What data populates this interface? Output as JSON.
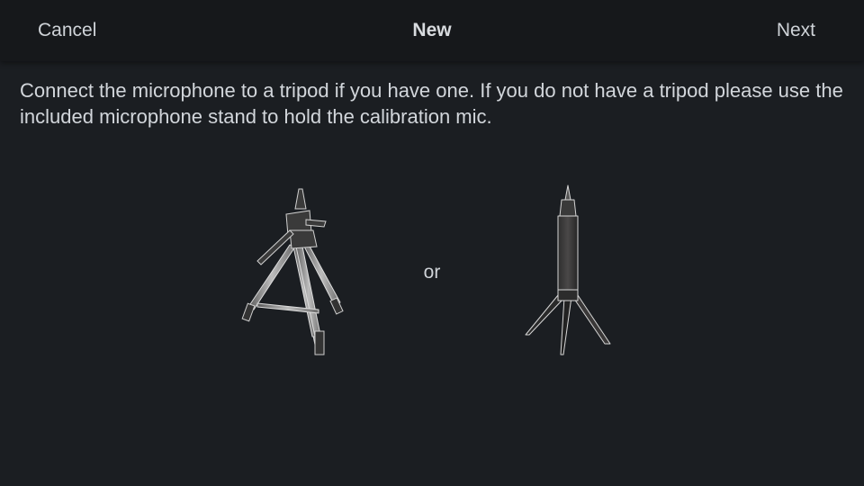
{
  "header": {
    "cancel_label": "Cancel",
    "title": "New",
    "next_label": "Next"
  },
  "main": {
    "instructions": "Connect the microphone to a tripod if you have one. If you do not have a tripod please use the included microphone stand to hold the calibration mic.",
    "or_label": "or",
    "illustrations": [
      {
        "icon": "tripod-icon"
      },
      {
        "icon": "microphone-stand-icon"
      }
    ]
  },
  "colors": {
    "background": "#1b1e22",
    "header_background": "#16181b",
    "text": "#d2d6db"
  }
}
